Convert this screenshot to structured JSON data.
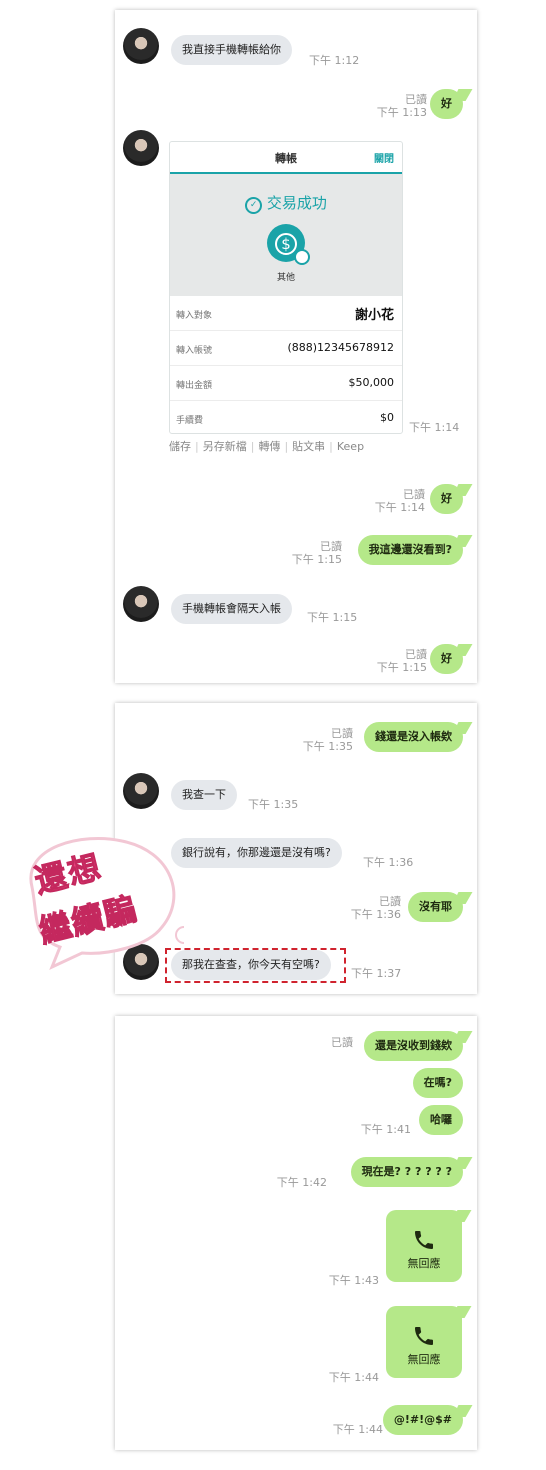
{
  "panel1": {
    "messages": [
      {
        "text": "我直接手機轉帳給你",
        "time": "下午 1:12"
      },
      {
        "text": "好",
        "read": "已讀",
        "time": "下午 1:13"
      },
      {
        "text": "好",
        "read": "已讀",
        "time": "下午 1:14"
      },
      {
        "text": "我這邊還沒看到?",
        "read": "已讀",
        "time": "下午 1:15"
      },
      {
        "text": "手機轉帳會隔天入帳",
        "time": "下午 1:15"
      },
      {
        "text": "好",
        "read": "已讀",
        "time": "下午 1:15"
      }
    ],
    "card": {
      "title": "轉帳",
      "close": "關閉",
      "status": "交易成功",
      "category": "其他",
      "rows": [
        {
          "label": "轉入對象",
          "value": "謝小花"
        },
        {
          "label": "轉入帳號",
          "value": "(888)12345678912"
        },
        {
          "label": "轉出金額",
          "value": "$50,000"
        },
        {
          "label": "手續費",
          "value": "$0"
        }
      ],
      "time": "下午 1:14"
    },
    "actions": [
      "儲存",
      "另存新檔",
      "轉傳",
      "貼文串",
      "Keep"
    ]
  },
  "panel2": {
    "messages": [
      {
        "text": "錢還是沒入帳欸",
        "read": "已讀",
        "time": "下午 1:35"
      },
      {
        "text": "我查一下",
        "time": "下午 1:35"
      },
      {
        "text": "銀行說有，你那邊還是沒有嗎?",
        "time": "下午 1:36"
      },
      {
        "text": "沒有耶",
        "read": "已讀",
        "time": "下午 1:36"
      },
      {
        "text": "那我在查查，你今天有空嗎?",
        "time": "下午 1:37"
      }
    ],
    "sticker": {
      "line1": "還想",
      "line2": "繼續騙"
    }
  },
  "panel3": {
    "messages": [
      {
        "text": "還是沒收到錢欸",
        "read": "已讀"
      },
      {
        "text": "在嗎?"
      },
      {
        "text": "哈囉",
        "time": "下午 1:41"
      },
      {
        "text": "現在是? ? ? ? ? ?",
        "time": "下午 1:42"
      },
      {
        "text": "無回應",
        "time": "下午 1:43"
      },
      {
        "text": "無回應",
        "time": "下午 1:44"
      },
      {
        "text": "@!#!@$#",
        "time": "下午 1:44"
      }
    ]
  },
  "icons": {
    "call": "phone-icon",
    "success": "check-circle-icon",
    "coin": "coin-icon"
  },
  "colors": {
    "outgoing_bubble": "#b5e889",
    "incoming_bubble": "#e5e8ec",
    "accent": "#1aa3a8",
    "sticker": "#e8407a",
    "highlight": "#d0232e"
  }
}
